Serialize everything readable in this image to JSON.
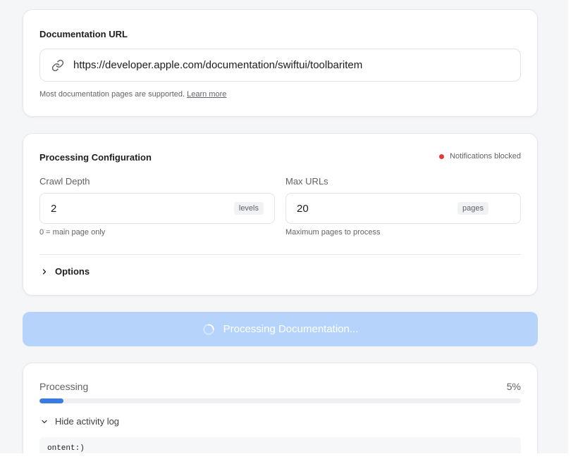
{
  "url_section": {
    "title": "Documentation URL",
    "url_value": "https://developer.apple.com/documentation/swiftui/toolbaritem",
    "hint_text": "Most documentation pages are supported.",
    "learn_more": "Learn more",
    "icon": "link-icon"
  },
  "config": {
    "title": "Processing Configuration",
    "notifications_status": "Notifications blocked",
    "status_color": "#e53935",
    "crawl_depth": {
      "label": "Crawl Depth",
      "value": "2",
      "unit": "levels",
      "hint": "0 = main page only"
    },
    "max_urls": {
      "label": "Max URLs",
      "value": "20",
      "unit": "pages",
      "hint": "Maximum pages to process"
    },
    "options_label": "Options"
  },
  "process_button": {
    "label": "Processing Documentation...",
    "color": "#b6d3fb"
  },
  "progress": {
    "label": "Processing",
    "percent_text": "5%",
    "percent": 5,
    "fill_color": "#3a7be0",
    "log_toggle": "Hide activity log",
    "log_line": "ontent:)"
  }
}
